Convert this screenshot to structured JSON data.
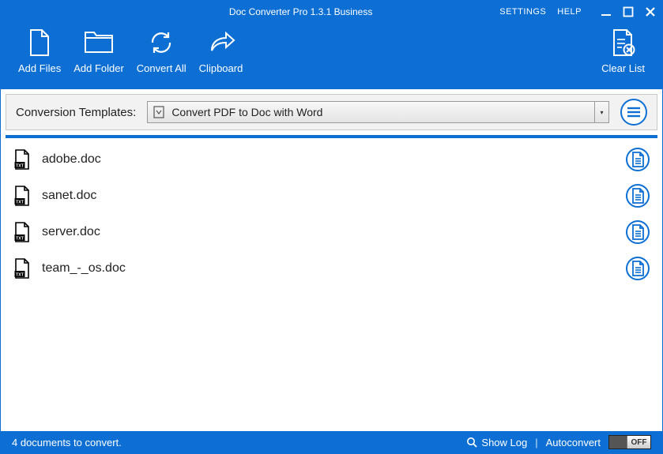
{
  "app": {
    "title": "Doc Converter Pro 1.3.1 Business"
  },
  "titlebarLinks": {
    "settings": "SETTINGS",
    "help": "HELP"
  },
  "toolbar": {
    "addFiles": "Add Files",
    "addFolder": "Add Folder",
    "convertAll": "Convert All",
    "clipboard": "Clipboard",
    "clearList": "Clear List"
  },
  "templates": {
    "label": "Conversion Templates:",
    "selected": "Convert PDF to Doc with Word"
  },
  "files": [
    {
      "name": "adobe.doc"
    },
    {
      "name": "sanet.doc"
    },
    {
      "name": "server.doc"
    },
    {
      "name": "team_-_os.doc"
    }
  ],
  "status": {
    "text": "4 documents to convert.",
    "showLog": "Show Log",
    "autoconvert": "Autoconvert",
    "toggleLabel": "OFF"
  }
}
